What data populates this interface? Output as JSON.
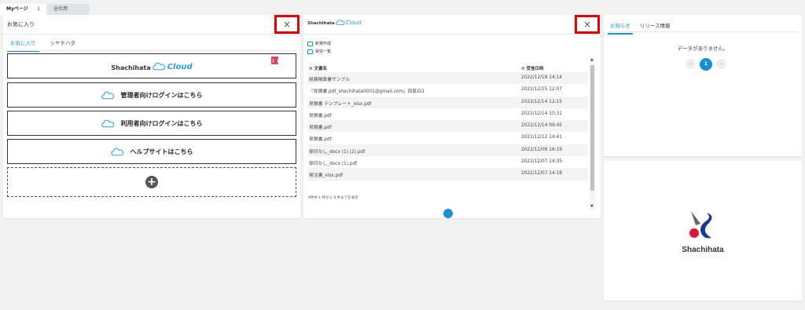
{
  "top_tabs": {
    "my_page": "Myページ",
    "menu_dots": "⋮",
    "common": "全社用"
  },
  "favorites": {
    "title": "お気に入り",
    "close": "×",
    "tabs": [
      "お気に入り",
      "シヤチハタ"
    ],
    "brand_part1": "Shachihata",
    "brand_part2": "Cloud",
    "links": [
      "管理者向けログインはこちら",
      "利用者向けログインはこちら",
      "ヘルプサイトはこちら"
    ],
    "add_symbol": "+"
  },
  "documents": {
    "brand_part1": "Shachihata",
    "brand_part2": "Cloud",
    "close": "×",
    "actions": [
      "新規作成",
      "受信一覧"
    ],
    "columns": [
      "文書名",
      "受信日時"
    ],
    "sort_symbol": "≎",
    "rows": [
      {
        "name": "経費精算書サンプル",
        "date": "2022/12/19 14:14"
      },
      {
        "name": "「見積書.pdf_shachihata0001@gmail.com」回覧ID1",
        "date": "2022/12/15 12:07"
      },
      {
        "name": "見積書 テンプレート_xlsx.pdf",
        "date": "2022/12/14 12:15"
      },
      {
        "name": "見積書.pdf",
        "date": "2022/12/14 10:31"
      },
      {
        "name": "見積書.pdf",
        "date": "2022/12/14 09:45"
      },
      {
        "name": "見積書.pdf",
        "date": "2022/12/12 14:41"
      },
      {
        "name": "捺印なし_docx (1) (2).pdf",
        "date": "2022/12/08 16:19"
      },
      {
        "name": "捺印なし_docx (1).pdf",
        "date": "2022/12/07 14:35"
      },
      {
        "name": "発注書_xlsx.pdf",
        "date": "2022/12/07 14:18"
      }
    ],
    "page_info": "9件中 1 件から 9 件までを表示",
    "scroll_up": "▲",
    "scroll_down": "▼"
  },
  "news": {
    "tabs": [
      "お知らせ",
      "リリース情報"
    ],
    "empty_message": "データがありません。",
    "pager": {
      "prev": "‹",
      "current": "1",
      "next": "›"
    }
  },
  "logo": {
    "wordmark": "Shachihata"
  },
  "colors": {
    "accent": "#1a8fd6",
    "highlight_box": "#e00000",
    "delete": "#e0445c"
  }
}
